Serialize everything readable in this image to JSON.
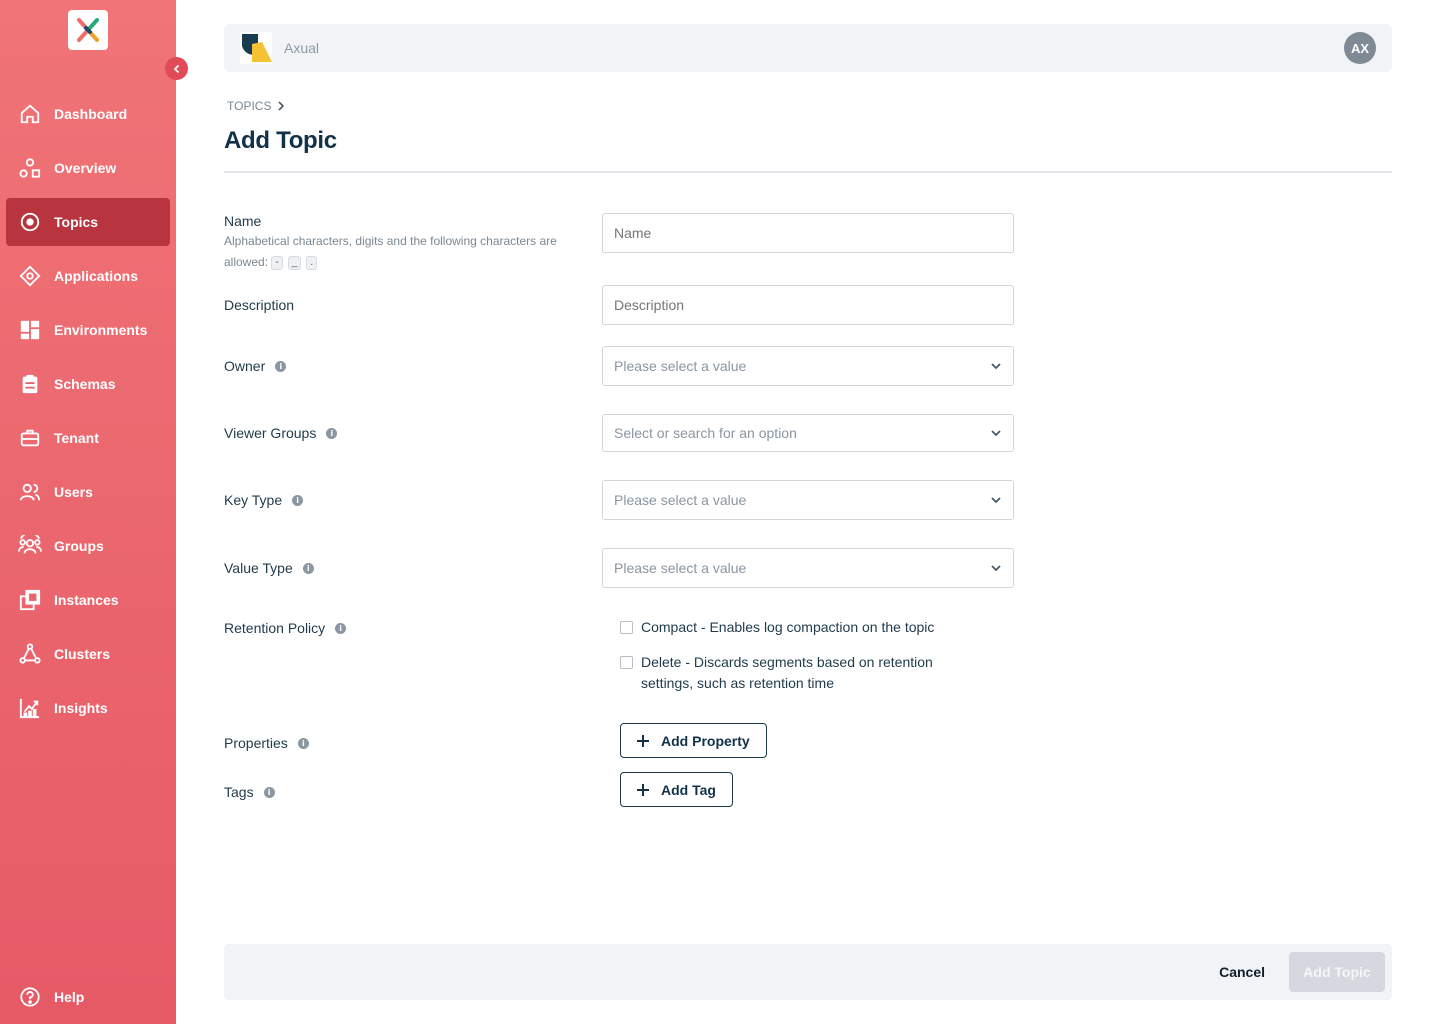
{
  "sidebar": {
    "logo_icon": "axual-x-logo",
    "collapse_icon": "chevron-left-icon",
    "items": [
      {
        "label": "Dashboard",
        "icon": "home-icon",
        "active": false
      },
      {
        "label": "Overview",
        "icon": "overview-icon",
        "active": false
      },
      {
        "label": "Topics",
        "icon": "topics-icon",
        "active": true
      },
      {
        "label": "Applications",
        "icon": "applications-icon",
        "active": false
      },
      {
        "label": "Environments",
        "icon": "environments-icon",
        "active": false
      },
      {
        "label": "Schemas",
        "icon": "schemas-icon",
        "active": false
      },
      {
        "label": "Tenant",
        "icon": "tenant-icon",
        "active": false
      },
      {
        "label": "Users",
        "icon": "users-icon",
        "active": false
      },
      {
        "label": "Groups",
        "icon": "groups-icon",
        "active": false
      },
      {
        "label": "Instances",
        "icon": "instances-icon",
        "active": false
      },
      {
        "label": "Clusters",
        "icon": "clusters-icon",
        "active": false
      },
      {
        "label": "Insights",
        "icon": "insights-icon",
        "active": false
      }
    ],
    "help": {
      "label": "Help",
      "icon": "help-icon"
    }
  },
  "topbar": {
    "tenant_name": "Axual",
    "avatar_initials": "AX"
  },
  "breadcrumb": {
    "label": "TOPICS"
  },
  "page": {
    "title": "Add Topic"
  },
  "form": {
    "name": {
      "label": "Name",
      "hint": "Alphabetical characters, digits and the following characters are allowed:",
      "allowed_chars": [
        "-",
        "_",
        "."
      ],
      "placeholder": "Name",
      "value": ""
    },
    "description": {
      "label": "Description",
      "placeholder": "Description",
      "value": ""
    },
    "owner": {
      "label": "Owner",
      "placeholder": "Please select a value"
    },
    "viewer_groups": {
      "label": "Viewer Groups",
      "placeholder": "Select or search for an option"
    },
    "key_type": {
      "label": "Key Type",
      "placeholder": "Please select a value"
    },
    "value_type": {
      "label": "Value Type",
      "placeholder": "Please select a value"
    },
    "retention_policy": {
      "label": "Retention Policy",
      "options": [
        {
          "label": "Compact - Enables log compaction on the topic",
          "checked": false
        },
        {
          "label": "Delete - Discards segments based on retention settings, such as retention time",
          "checked": false
        }
      ]
    },
    "properties": {
      "label": "Properties",
      "button": "Add Property"
    },
    "tags": {
      "label": "Tags",
      "button": "Add Tag"
    }
  },
  "footer": {
    "cancel_label": "Cancel",
    "submit_label": "Add Topic"
  },
  "colors": {
    "sidebar_top": "#f07478",
    "sidebar_bottom": "#e65a66",
    "active_nav": "#b8353f",
    "title": "#12324a"
  }
}
